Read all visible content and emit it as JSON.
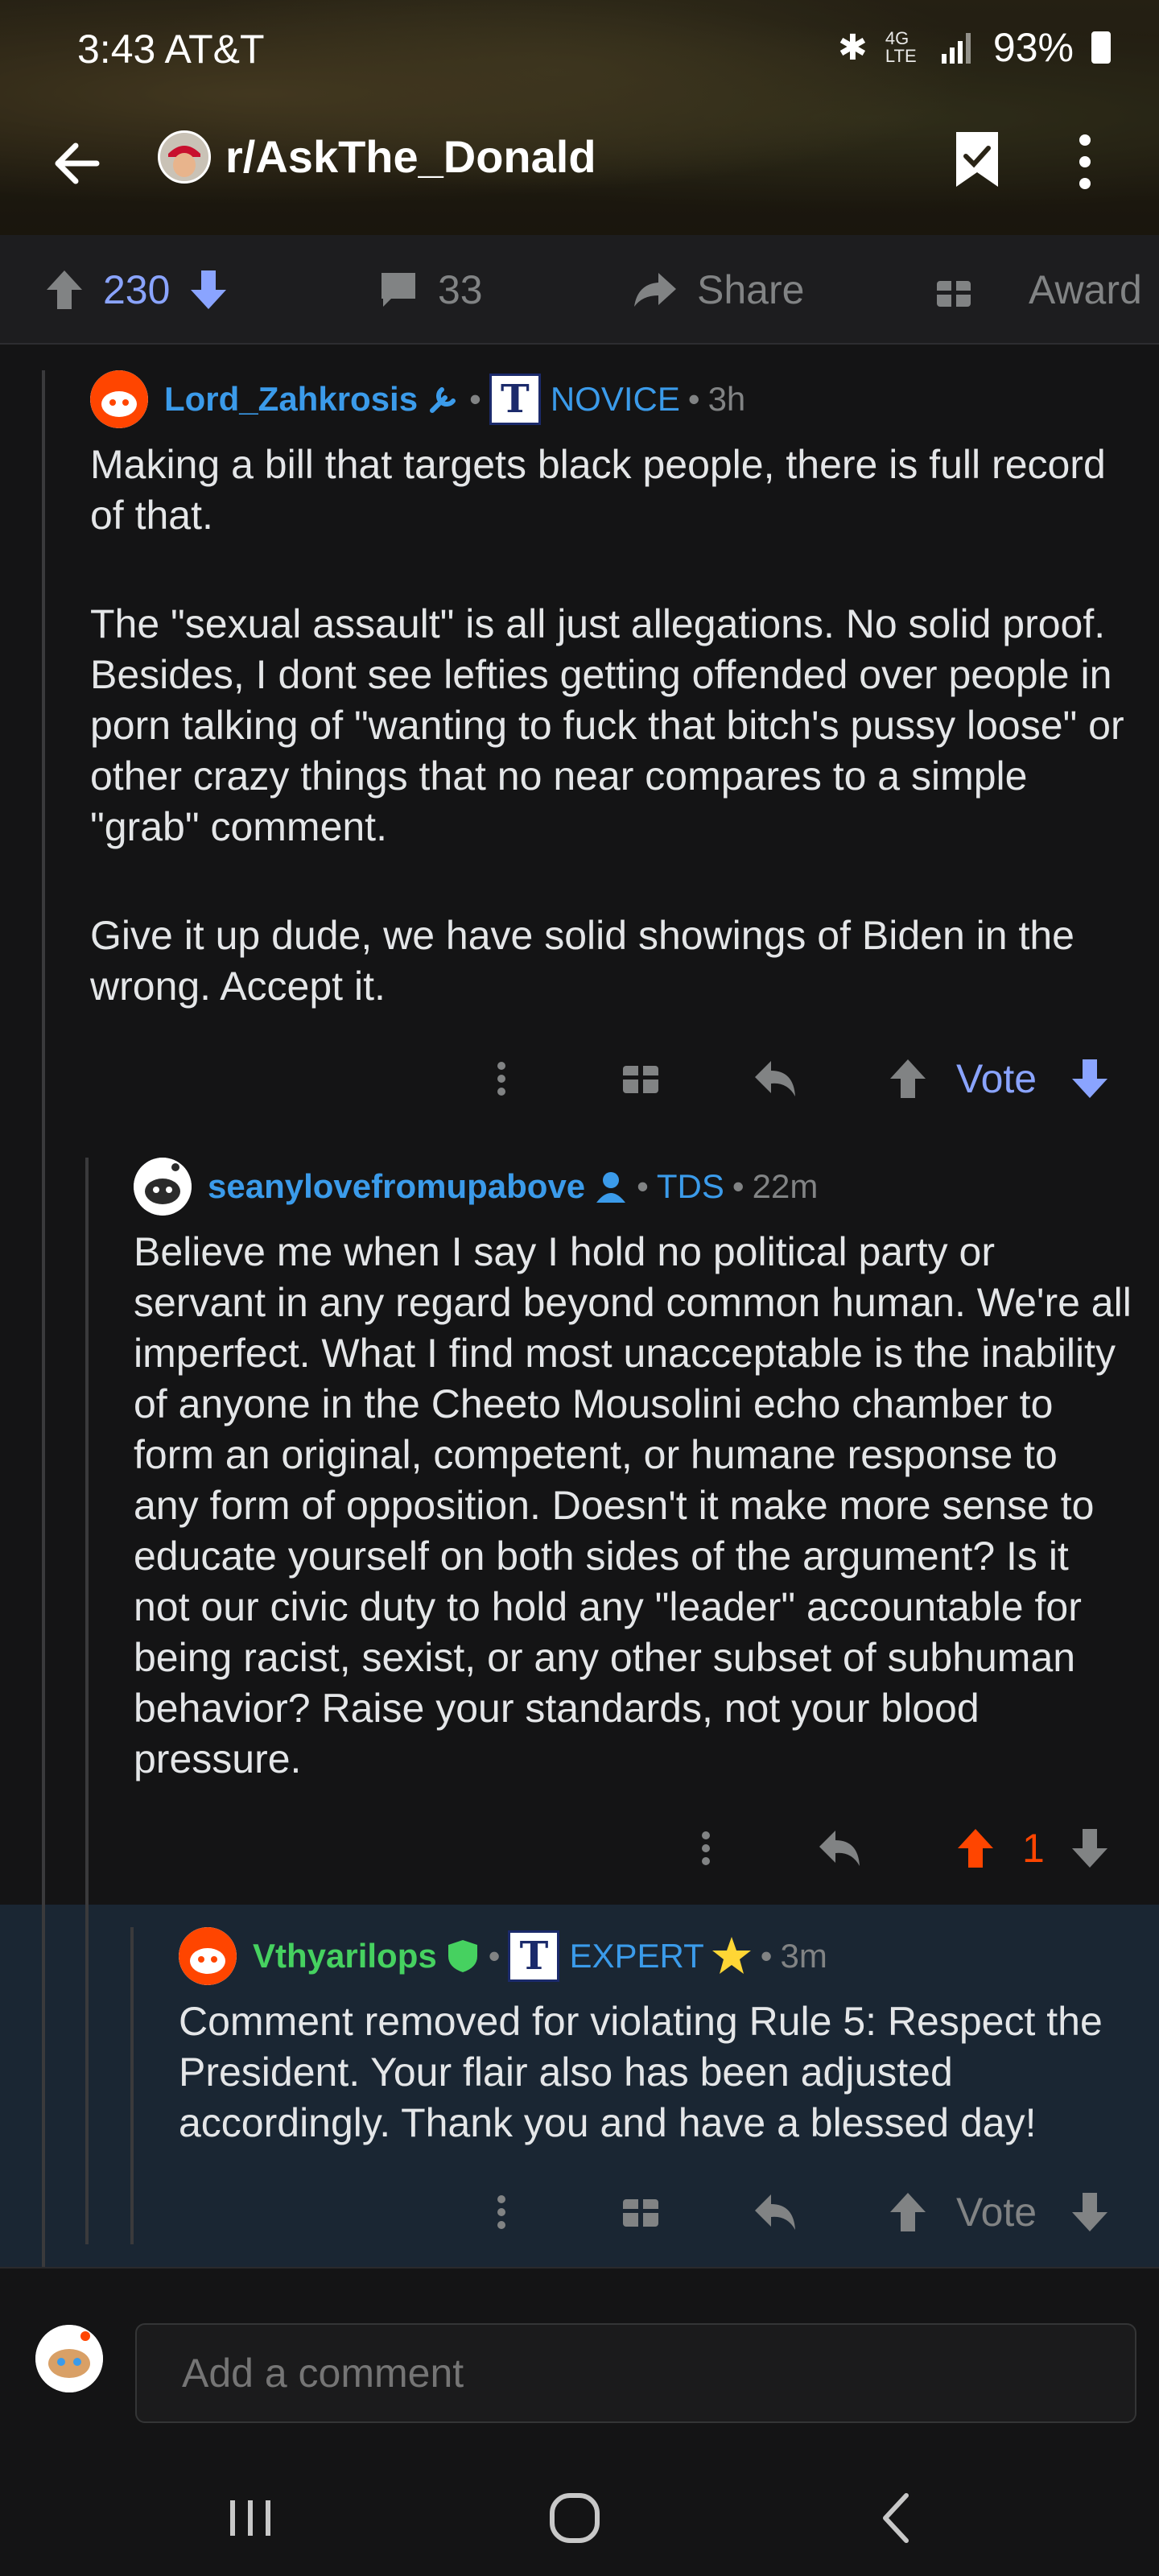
{
  "status_bar": {
    "time": "3:43 AT&T",
    "network": "4G LTE",
    "battery": "93%"
  },
  "nav": {
    "subreddit": "r/AskThe_Donald"
  },
  "post_actions": {
    "score": "230",
    "comments": "33",
    "share_label": "Share",
    "award_label": "Award"
  },
  "comments": [
    {
      "username": "Lord_Zahkrosis",
      "flair_badge": "T",
      "flair": "NOVICE",
      "time": "3h",
      "paragraphs": [
        "Making a bill that targets black people, there is full record of that.",
        "The \"sexual assault\" is all just allegations. No solid proof. Besides, I dont see lefties getting offended over people in porn talking of \"wanting to fuck that bitch's pussy loose\" or other crazy things that no near compares to a simple \"grab\" comment.",
        "Give it up dude, we have solid showings of Biden in the wrong. Accept it."
      ],
      "vote_label": "Vote"
    },
    {
      "username": "seanylovefromupabove",
      "flair": "TDS",
      "time": "22m",
      "paragraphs": [
        "Believe me when I say I hold no political party or servant in any regard beyond common human. We're all imperfect. What I find most unacceptable is the inability of anyone in the Cheeto Mousolini echo chamber to form an original, competent, or humane response to any form of opposition. Doesn't it make more sense to educate yourself on both sides of the argument? Is it not our civic duty to hold any \"leader\" accountable for being racist, sexist, or any other subset of subhuman behavior? Raise your standards, not your blood pressure."
      ],
      "score": "1"
    },
    {
      "username": "Vthyarilops",
      "flair_badge": "T",
      "flair": "EXPERT",
      "time": "3m",
      "paragraphs": [
        "Comment removed for violating Rule 5: Respect the President. Your flair also has been adjusted accordingly. Thank you and have a blessed day!"
      ],
      "vote_label": "Vote"
    }
  ],
  "composer": {
    "placeholder": "Add a comment"
  },
  "colors": {
    "accent_blue": "#3b9bea",
    "vote_blue": "#8aa4ff",
    "upvote_orange": "#ff4500",
    "mod_green": "#46d160",
    "highlight_bg": "#1a2633"
  }
}
